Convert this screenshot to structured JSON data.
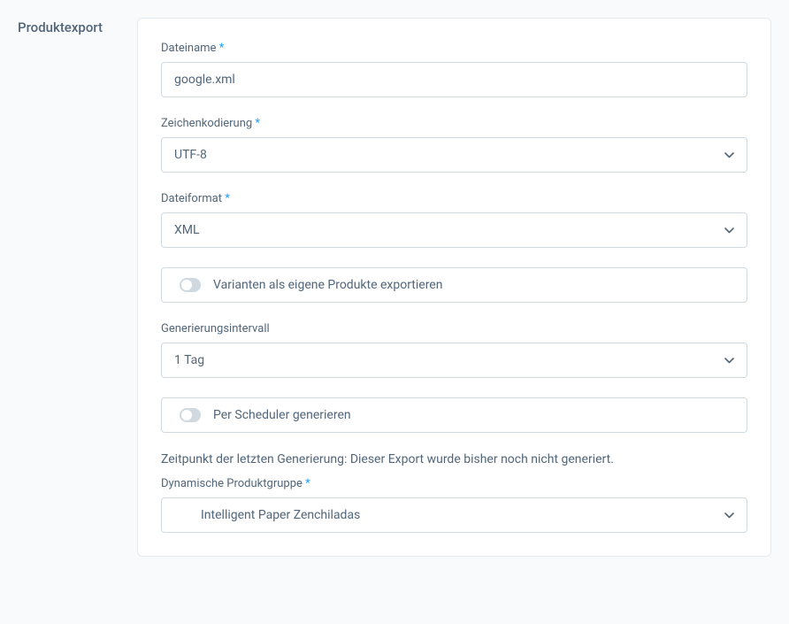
{
  "section": {
    "title": "Produktexport"
  },
  "fields": {
    "filename": {
      "label": "Dateiname",
      "value": "google.xml"
    },
    "encoding": {
      "label": "Zeichenkodierung",
      "value": "UTF-8"
    },
    "fileformat": {
      "label": "Dateiformat",
      "value": "XML"
    },
    "variantsToggle": {
      "label": "Varianten als eigene Produkte exportieren"
    },
    "interval": {
      "label": "Generierungsintervall",
      "value": "1 Tag"
    },
    "schedulerToggle": {
      "label": "Per Scheduler generieren"
    },
    "lastGenerated": {
      "text": "Zeitpunkt der letzten Generierung: Dieser Export wurde bisher noch nicht generiert."
    },
    "productGroup": {
      "label": "Dynamische Produktgruppe",
      "value": "Intelligent Paper Zenchiladas"
    }
  },
  "requiredMark": "*"
}
